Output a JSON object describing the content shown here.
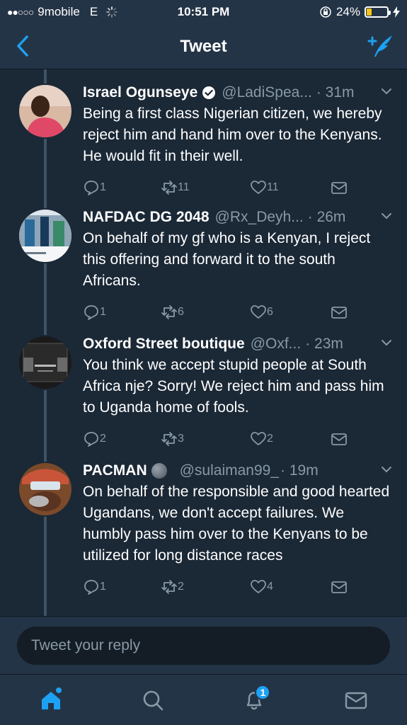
{
  "status_bar": {
    "signal": "●●○○○",
    "carrier": "9mobile",
    "network": "E",
    "time": "10:51 PM",
    "battery": "24%",
    "battery_level": 0.24
  },
  "nav": {
    "title": "Tweet"
  },
  "tweets": [
    {
      "name": "Israel Ogunseye",
      "verified": true,
      "handle": "@LadiSpea...",
      "time": "· 31m",
      "text": "Being a first class Nigerian citizen, we hereby reject him and hand him over to the Kenyans. He would fit in their well.",
      "replies": "1",
      "retweets": "11",
      "likes": "11"
    },
    {
      "name": "NAFDAC DG 2048",
      "verified": false,
      "handle": "@Rx_Deyh...",
      "time": "· 26m",
      "text": "On behalf of my gf who is a Kenyan, I reject this offering and forward it to the south Africans.",
      "replies": "1",
      "retweets": "6",
      "likes": "6"
    },
    {
      "name": "Oxford Street boutique",
      "verified": false,
      "handle": "@Oxf...",
      "time": "· 23m",
      "text": "You think we accept stupid people at South Africa nje? Sorry! We reject him and pass him to Uganda home of fools.",
      "replies": "2",
      "retweets": "3",
      "likes": "2"
    },
    {
      "name": "PACMAN",
      "verified": false,
      "handle": "@sulaiman99_",
      "time": "· 19m",
      "text": "On behalf of the responsible and good hearted Ugandans, we don't accept failures. We humbly pass him over to the Kenyans to be utilized for long distance races",
      "replies": "1",
      "retweets": "2",
      "likes": "4"
    }
  ],
  "reply_bar": {
    "placeholder": "Tweet your reply"
  },
  "tab_bar": {
    "notifications_badge": "1"
  },
  "colors": {
    "background": "#1b2836",
    "bar": "#243447",
    "accent": "#1da1f2",
    "secondary_text": "#8899a6"
  }
}
